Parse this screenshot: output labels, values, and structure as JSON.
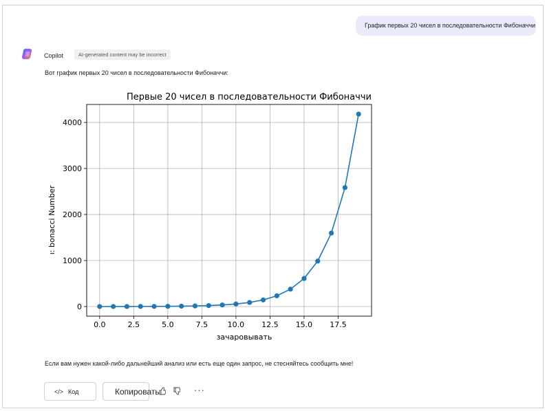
{
  "conversation": {
    "user_message": "График первых 20 чисел в последовательности Фибоначчи",
    "assistant_name": "Copilot",
    "ai_badge": "AI-generated content may be incorrect",
    "intro_text": "Вот график первых 20 чисел в последовательности Фибоначчи:",
    "outro_text": "Если вам нужен какой-либо дальнейший анализ или есть еще один запрос, не стесняйтесь сообщить мне!"
  },
  "actions": {
    "code_label": "Код",
    "copy_label": "Копировать",
    "more_label": "···"
  },
  "icons": {
    "code": "code-icon",
    "copy": "copy-icon",
    "like": "thumbs-up-icon",
    "dislike": "thumbs-down-icon",
    "more": "more-icon",
    "logo": "copilot-logo-icon"
  },
  "colors": {
    "series": "#1f77b4",
    "user_bubble": "#e9ebfd"
  },
  "chart_data": {
    "type": "line",
    "title": "Первые 20 чисел в последовательности Фибоначчи",
    "xlabel": "зачаровывать",
    "ylabel": "ı: bonacci Number",
    "x": [
      0,
      1,
      2,
      3,
      4,
      5,
      6,
      7,
      8,
      9,
      10,
      11,
      12,
      13,
      14,
      15,
      16,
      17,
      18,
      19
    ],
    "values": [
      0,
      1,
      1,
      2,
      3,
      5,
      8,
      13,
      21,
      34,
      55,
      89,
      144,
      233,
      377,
      610,
      987,
      1597,
      2584,
      4181
    ],
    "xlim": [
      -0.95,
      19.95
    ],
    "ylim": [
      -209,
      4390
    ],
    "xticks": [
      0.0,
      2.5,
      5.0,
      7.5,
      10.0,
      12.5,
      15.0,
      17.5
    ],
    "xtick_labels": [
      "0.0",
      "2.5",
      "5.0",
      "7.5",
      "10.0",
      "12.5",
      "15.0",
      "17.5"
    ],
    "yticks": [
      0,
      1000,
      2000,
      3000,
      4000
    ],
    "ytick_labels": [
      "0",
      "1000",
      "2000",
      "3000",
      "4000"
    ],
    "grid": true,
    "markers": true
  }
}
